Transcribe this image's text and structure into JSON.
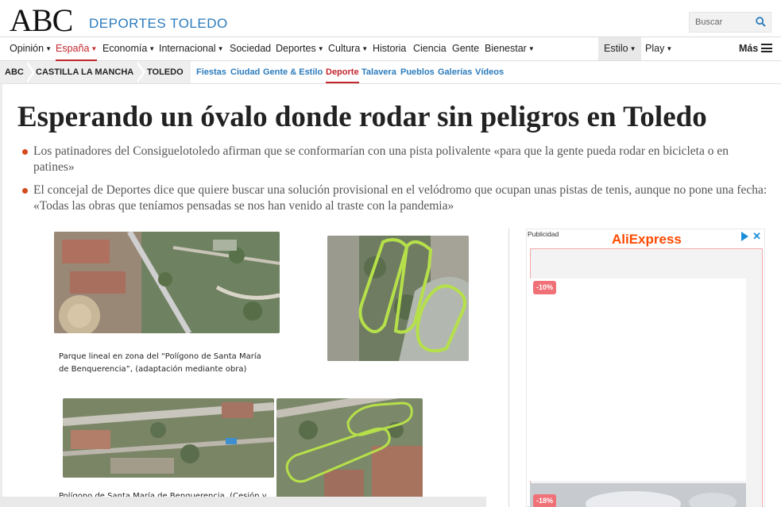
{
  "header": {
    "logo": "ABC",
    "section": "DEPORTES TOLEDO",
    "search_placeholder": "Buscar"
  },
  "nav": {
    "items": [
      {
        "label": "Opinión",
        "caret": true
      },
      {
        "label": "España",
        "caret": true,
        "active": true
      },
      {
        "label": "Economía",
        "caret": true
      },
      {
        "label": "Internacional",
        "caret": true
      },
      {
        "label": "Sociedad",
        "caret": false
      },
      {
        "label": "Deportes",
        "caret": true
      },
      {
        "label": "Cultura",
        "caret": true
      },
      {
        "label": "Historia",
        "caret": false
      },
      {
        "label": "Ciencia",
        "caret": false
      },
      {
        "label": "Gente",
        "caret": false
      },
      {
        "label": "Bienestar",
        "caret": true
      },
      {
        "label": "Estilo",
        "caret": true
      },
      {
        "label": "Play",
        "caret": true
      }
    ],
    "more_label": "Más"
  },
  "breadcrumbs": [
    "ABC",
    "CASTILLA LA MANCHA",
    "TOLEDO"
  ],
  "sublinks": [
    {
      "label": "Fiestas"
    },
    {
      "label": "Ciudad"
    },
    {
      "label": "Gente & Estilo"
    },
    {
      "label": "Deporte",
      "active": true
    },
    {
      "label": "Talavera"
    },
    {
      "label": "Pueblos"
    },
    {
      "label": "Galerías"
    },
    {
      "label": "Vídeos"
    }
  ],
  "article": {
    "headline": "Esperando un óvalo donde rodar sin peligros en Toledo",
    "bullets": [
      "Los patinadores del Consiguelotoledo afirman que se conformarían con una pista polivalente «para que la gente pueda rodar en bicicleta o en patines»",
      "El concejal de Deportes dice que quiere buscar una solución provisional en el velódromo que ocupan unas pistas de tenis, aunque no pone una fecha: «Todas las obras que teníamos pensadas se nos han venido al traste con la pandemia»"
    ],
    "captions": [
      "Parque lineal en zona del “Polígono de Santa María de Benquerencia”, (adaptación mediante obra)",
      "Polígono de Santa María de Benquerencia, (Cesión y"
    ]
  },
  "ad": {
    "label": "Publicidad",
    "brand": "AliExpress",
    "discounts": [
      "-10%",
      "-18%"
    ],
    "prev": "◀",
    "next": "▶",
    "colors": {
      "brand": "#ff4a00",
      "badge": "#f07077",
      "adchoices": "#1a8fd8"
    }
  },
  "colors": {
    "accent_red": "#c4262e",
    "link_blue": "#2b7bbd",
    "bullet": "#d44b1f"
  }
}
